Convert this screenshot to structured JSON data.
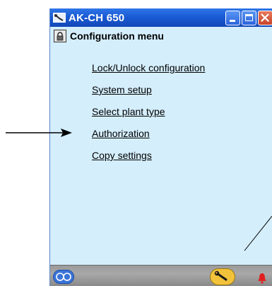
{
  "window": {
    "title": "AK-CH 650",
    "icons": {
      "app": "wrench-app-icon",
      "minimize": "minimize-icon",
      "maximize": "maximize-icon",
      "close": "close-icon"
    }
  },
  "menu": {
    "icon": "lock-icon",
    "title": "Configuration menu",
    "items": [
      {
        "label": "Lock/Unlock configuration"
      },
      {
        "label": "System setup"
      },
      {
        "label": "Select plant type"
      },
      {
        "label": "Authorization"
      },
      {
        "label": "Copy settings"
      }
    ]
  },
  "statusbar": {
    "icons": {
      "left": "goggles-icon",
      "service": "wrench-icon",
      "alarm": "bell-alarm-icon"
    }
  },
  "colors": {
    "titlebar": "#1a5bd4",
    "window_bg": "#d4eefc",
    "close_button": "#c8452a",
    "service_badge": "#f2c23a",
    "alarm": "#e02020"
  }
}
